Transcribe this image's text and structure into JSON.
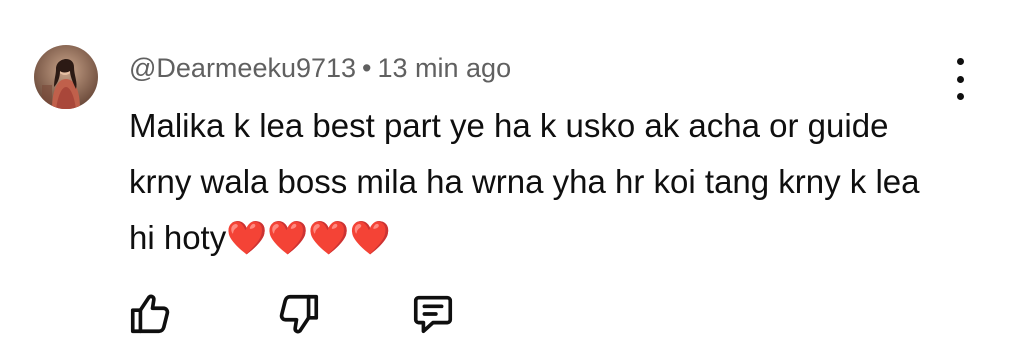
{
  "comment": {
    "author": "@Dearmeeku9713",
    "separator": "•",
    "time_ago": "13 min ago",
    "text": "Malika k lea best part ye ha k usko ak acha or guide krny wala boss mila ha wrna yha hr koi tang krny k lea hi hoty❤️❤️❤️❤️"
  },
  "icons": {
    "avatar": "user-avatar",
    "menu": "more-vert-icon",
    "like": "thumbs-up-icon",
    "dislike": "thumbs-down-icon",
    "reply": "reply-comment-icon"
  },
  "colors": {
    "text": "#0f0f0f",
    "meta": "#606060",
    "background": "#ffffff"
  }
}
